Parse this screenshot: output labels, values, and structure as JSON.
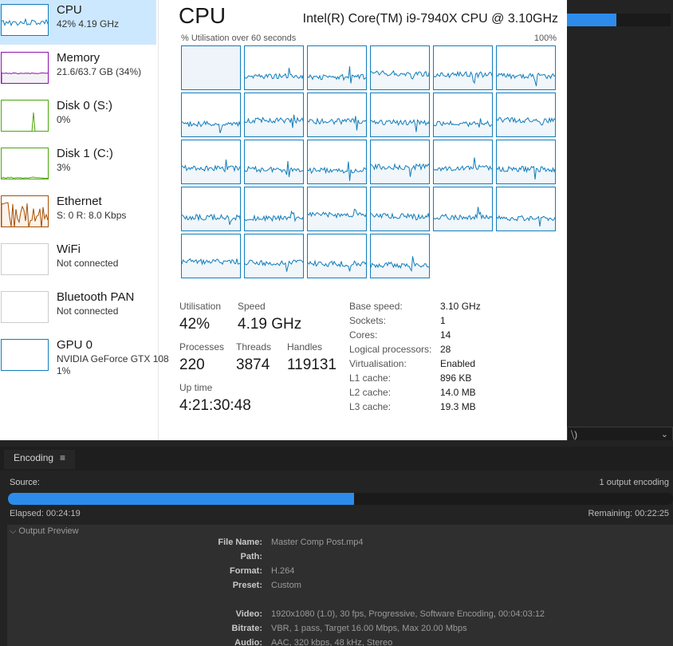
{
  "task_manager": {
    "sidebar": [
      {
        "title": "CPU",
        "sub": "42% 4.19 GHz",
        "sub2": "",
        "color": "#117dbb",
        "kind": "cpu"
      },
      {
        "title": "Memory",
        "sub": "21.6/63.7 GB (34%)",
        "sub2": "",
        "color": "#8b12ae",
        "kind": "memory"
      },
      {
        "title": "Disk 0 (S:)",
        "sub": "0%",
        "sub2": "",
        "color": "#4da60c",
        "kind": "disk0"
      },
      {
        "title": "Disk 1 (C:)",
        "sub": "3%",
        "sub2": "",
        "color": "#4da60c",
        "kind": "disk1"
      },
      {
        "title": "Ethernet",
        "sub": "S: 0 R: 8.0 Kbps",
        "sub2": "",
        "color": "#a74f01",
        "kind": "ethernet"
      },
      {
        "title": "WiFi",
        "sub": "Not connected",
        "sub2": "",
        "color": "#cccccc",
        "kind": "empty"
      },
      {
        "title": "Bluetooth PAN",
        "sub": "Not connected",
        "sub2": "",
        "color": "#cccccc",
        "kind": "empty"
      },
      {
        "title": "GPU 0",
        "sub": "NVIDIA GeForce GTX 108",
        "sub2": "1%",
        "color": "#117dbb",
        "kind": "gpu"
      }
    ],
    "cpu_heading": "CPU",
    "cpu_name": "Intel(R) Core(TM) i9-7940X CPU @ 3.10GHz",
    "util_caption": "% Utilisation over 60 seconds",
    "util_max": "100%",
    "core_count": 28,
    "stats": {
      "utilisation_label": "Utilisation",
      "utilisation": "42%",
      "speed_label": "Speed",
      "speed": "4.19 GHz",
      "processes_label": "Processes",
      "processes": "220",
      "threads_label": "Threads",
      "threads": "3874",
      "handles_label": "Handles",
      "handles": "119131",
      "uptime_label": "Up time",
      "uptime": "4:21:30:48"
    },
    "specs": [
      {
        "label": "Base speed:",
        "value": "3.10 GHz"
      },
      {
        "label": "Sockets:",
        "value": "1"
      },
      {
        "label": "Cores:",
        "value": "14"
      },
      {
        "label": "Logical processors:",
        "value": "28"
      },
      {
        "label": "Virtualisation:",
        "value": "Enabled"
      },
      {
        "label": "L1 cache:",
        "value": "896 KB"
      },
      {
        "label": "L2 cache:",
        "value": "14.0 MB"
      },
      {
        "label": "L3 cache:",
        "value": "19.3 MB"
      }
    ]
  },
  "background": {
    "dropdown_text": "⧹)",
    "mini_progress": 0.48
  },
  "encoding": {
    "tab_label": "Encoding",
    "source_label": "Source:",
    "output_count": "1 output encoding",
    "progress": 0.52,
    "elapsed": "Elapsed: 00:24:19",
    "remaining": "Remaining: 00:22:25",
    "preview_header": "Output Preview",
    "details": [
      {
        "label": "File Name:",
        "value": "Master Comp Post.mp4"
      },
      {
        "label": "Path:",
        "value": ""
      },
      {
        "label": "Format:",
        "value": "H.264"
      },
      {
        "label": "Preset:",
        "value": "Custom"
      },
      {
        "label": "",
        "value": ""
      },
      {
        "label": "Video:",
        "value": "1920x1080 (1.0), 30 fps, Progressive, Software Encoding, 00:04:03:12"
      },
      {
        "label": "Bitrate:",
        "value": "VBR, 1 pass, Target 16.00 Mbps, Max 20.00 Mbps"
      },
      {
        "label": "Audio:",
        "value": "AAC, 320 kbps, 48 kHz, Stereo"
      }
    ]
  },
  "colors": {
    "accent_blue": "#2d8ceb",
    "cpu_line": "#117dbb",
    "selected_bg": "#cce8ff"
  }
}
